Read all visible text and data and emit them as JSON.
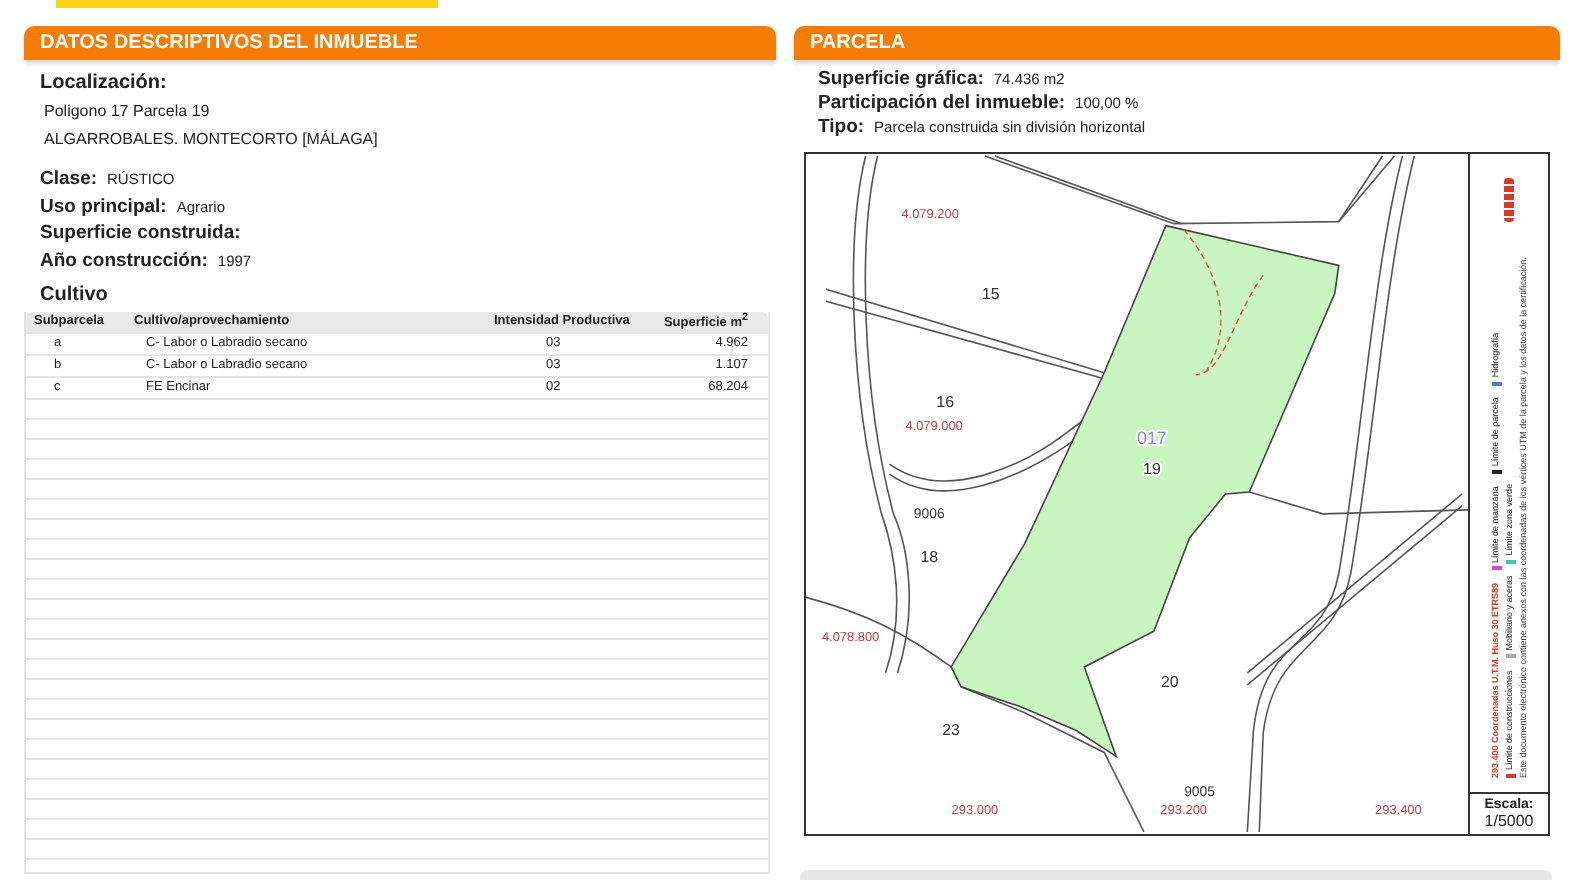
{
  "descriptive": {
    "title": "DATOS DESCRIPTIVOS DEL INMUEBLE",
    "location": {
      "label": "Localización:",
      "lines": [
        "Poligono 17 Parcela 19",
        "ALGARROBALES. MONTECORTO [MÁLAGA]"
      ]
    },
    "attributes": [
      {
        "label": "Clase:",
        "value": "RÚSTICO"
      },
      {
        "label": "Uso principal:",
        "value": "Agrario"
      },
      {
        "label": "Superficie construida:"
      },
      {
        "label": "Año construcción:",
        "value": "1997"
      }
    ],
    "cultivo": {
      "title": "Cultivo",
      "columns": [
        "Subparcela",
        "Cultivo/aprovechamiento",
        "Intensidad Productiva",
        "Superficie m$^{2}$"
      ],
      "rows": [
        [
          "a",
          "C- Labor o Labradio secano",
          "03",
          "4.962"
        ],
        [
          "b",
          "C- Labor o Labradio secano",
          "03",
          "1.107"
        ],
        [
          "c",
          "FE Encinar",
          "02",
          "68.204"
        ]
      ]
    }
  },
  "parcela": {
    "title": "PARCELA",
    "fields": [
      {
        "label": "Superficie gráfica:",
        "value": "74.436 m2"
      },
      {
        "label": "Participación del inmueble:",
        "value": "100,00 %"
      },
      {
        "label": "Tipo:",
        "value": "Parcela construida sin división horizontal"
      }
    ],
    "map": {
      "parcel_labels": [
        {
          "text": "15",
          "kind": "parcel"
        },
        {
          "text": "16",
          "kind": "parcel"
        },
        {
          "text": "9006",
          "kind": "road"
        },
        {
          "text": "18",
          "kind": "parcel"
        },
        {
          "text": "017",
          "kind": "polygon"
        },
        {
          "text": "19",
          "kind": "parcel"
        },
        {
          "text": "20",
          "kind": "parcel"
        },
        {
          "text": "23",
          "kind": "parcel"
        },
        {
          "text": "9005",
          "kind": "road"
        }
      ],
      "coordinate_labels": [
        {
          "text": "4.079.200",
          "kind": "y"
        },
        {
          "text": "4.079.000",
          "kind": "y"
        },
        {
          "text": "4.078.800",
          "kind": "y"
        },
        {
          "text": "293.000",
          "kind": "x"
        },
        {
          "text": "293.200",
          "kind": "x"
        },
        {
          "text": "293.400",
          "kind": "x"
        }
      ],
      "coordinates_note": "293.400 Coordenadas U.T.M. Huso 30 ETRS89",
      "legend": [
        {
          "label": "Límite de manzana",
          "color": "#e040e0"
        },
        {
          "label": "Límite de parcela",
          "color": "#222222"
        },
        {
          "label": "Hidrografía",
          "color": "#4a7fd4"
        },
        {
          "label": "Límite de construcciones",
          "color": "#d83a2a"
        },
        {
          "label": "Mobiliario y aceras",
          "color": "#aaaaaa"
        },
        {
          "label": "Límite zona verde",
          "color": "#3fc9b0"
        }
      ],
      "note": "Este documento electrónico contiene anexos con las coordenadas de los vértices UTM de la parcela y los datos de la certificación.",
      "scale_label": "Escala:",
      "scale": "1/5000"
    }
  }
}
